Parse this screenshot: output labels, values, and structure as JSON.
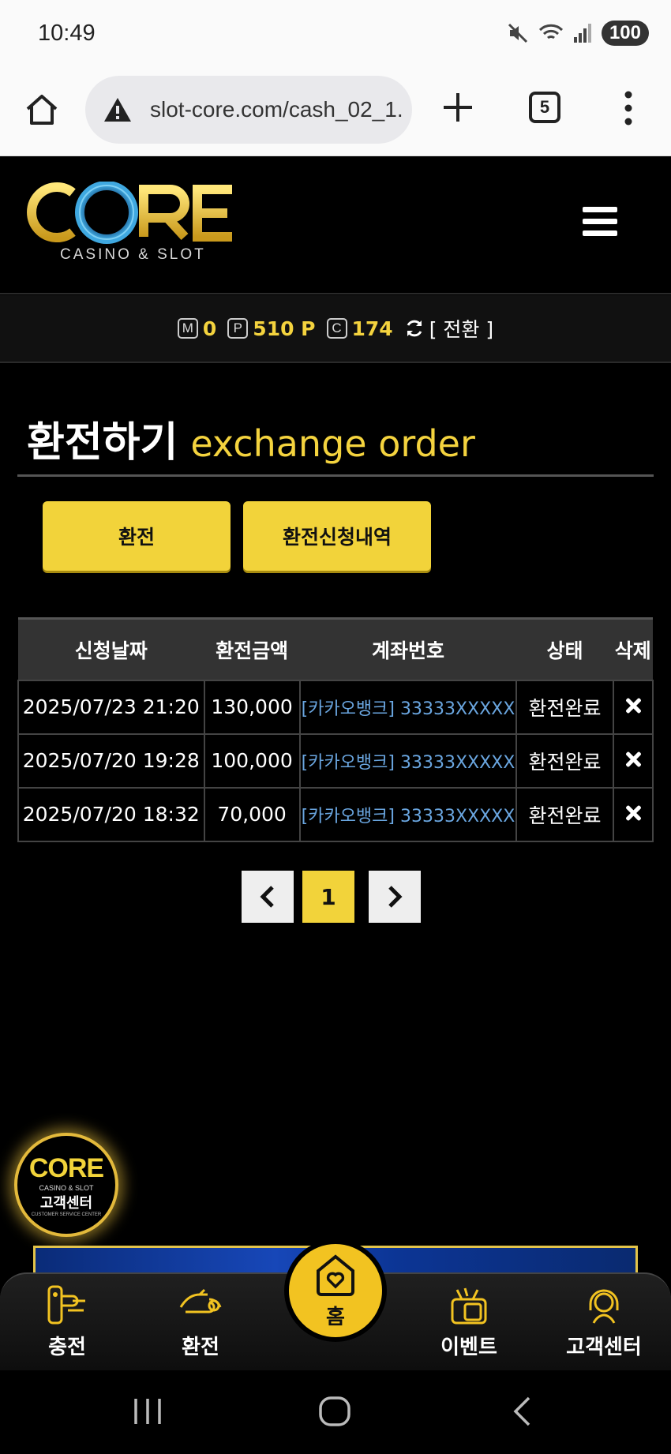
{
  "status": {
    "time": "10:49",
    "battery": "100"
  },
  "browser": {
    "url": "slot-core.com/cash_02_1.",
    "tab_count": "5"
  },
  "logo": {
    "main": "CORE",
    "sub": "CASINO & SLOT"
  },
  "balance": {
    "m_badge": "M",
    "m_value": "0",
    "p_badge": "P",
    "p_value": "510 P",
    "c_badge": "C",
    "c_value": "174",
    "switch_label": "[ 전환 ]"
  },
  "page": {
    "title_ko": "환전하기",
    "title_en": "exchange order"
  },
  "buttons": {
    "exchange": "환전",
    "history": "환전신청내역"
  },
  "table": {
    "headers": [
      "신청날짜",
      "환전금액",
      "계좌번호",
      "상태",
      "삭제"
    ],
    "rows": [
      {
        "date": "2025/07/23 21:20",
        "amount": "130,000",
        "account": "[카카오뱅크] 33333XXXXX",
        "status": "환전완료"
      },
      {
        "date": "2025/07/20 19:28",
        "amount": "100,000",
        "account": "[카카오뱅크] 33333XXXXX",
        "status": "환전완료"
      },
      {
        "date": "2025/07/20 18:32",
        "amount": "70,000",
        "account": "[카카오뱅크] 33333XXXXX",
        "status": "환전완료"
      }
    ]
  },
  "pagination": {
    "current": "1"
  },
  "cs_badge": {
    "logo": "CORE",
    "sub": "CASINO & SLOT",
    "label": "고객센터",
    "tiny": "CUSTOMER SERVICE CENTER"
  },
  "bottom_nav": {
    "deposit": "충전",
    "exchange": "환전",
    "home": "홈",
    "event": "이벤트",
    "support": "고객센터"
  },
  "colors": {
    "accent": "#f2d33a",
    "account_link": "#6aa6e0",
    "background": "#000000"
  }
}
